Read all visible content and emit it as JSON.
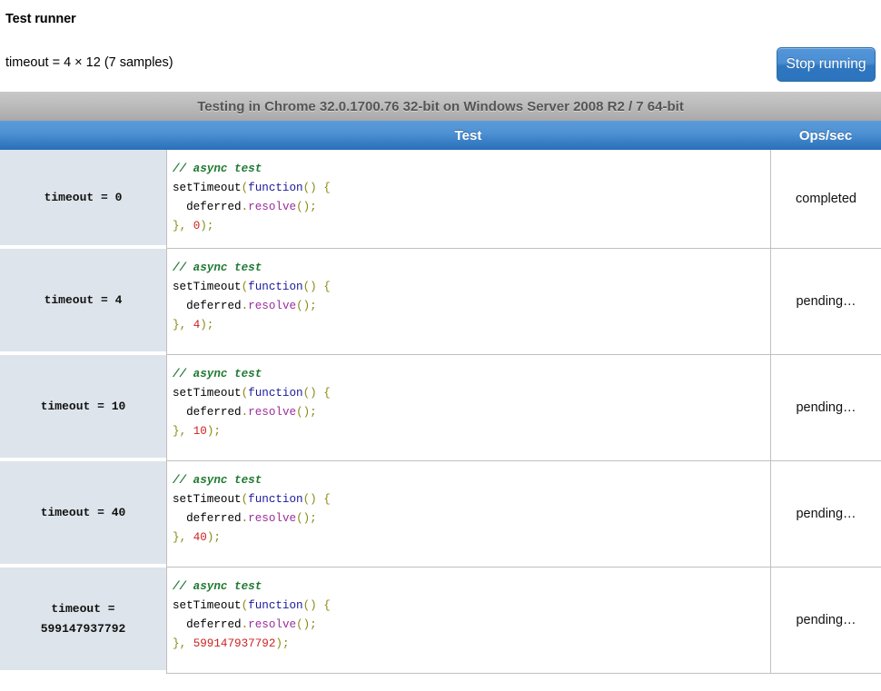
{
  "header": {
    "title": "Test runner",
    "subtitle": "timeout = 4 × 12 (7 samples)",
    "stop_button_label": "Stop running"
  },
  "table": {
    "caption": "Testing in Chrome 32.0.1700.76 32-bit on Windows Server 2008 R2 / 7 64-bit",
    "columns": {
      "name": "",
      "test": "Test",
      "ops": "Ops/sec"
    },
    "rows": [
      {
        "name": "timeout = 0",
        "code": {
          "comment": "// async test",
          "line2_fn": "setTimeout",
          "line2_open": "(",
          "line2_kw": "function",
          "line2_args": "()",
          "line2_brace": " {",
          "line3_indent": "  ",
          "line3_obj": "deferred",
          "line3_dot": ".",
          "line3_meth": "resolve",
          "line3_tail": "();",
          "line4_brace": "}",
          "line4_comma": ", ",
          "line4_num": "0",
          "line4_tail": ");"
        },
        "ops": "completed"
      },
      {
        "name": "timeout = 4",
        "code": {
          "comment": "// async test",
          "line2_fn": "setTimeout",
          "line2_open": "(",
          "line2_kw": "function",
          "line2_args": "()",
          "line2_brace": " {",
          "line3_indent": "  ",
          "line3_obj": "deferred",
          "line3_dot": ".",
          "line3_meth": "resolve",
          "line3_tail": "();",
          "line4_brace": "}",
          "line4_comma": ", ",
          "line4_num": "4",
          "line4_tail": ");"
        },
        "ops": "pending…"
      },
      {
        "name": "timeout = 10",
        "code": {
          "comment": "// async test",
          "line2_fn": "setTimeout",
          "line2_open": "(",
          "line2_kw": "function",
          "line2_args": "()",
          "line2_brace": " {",
          "line3_indent": "  ",
          "line3_obj": "deferred",
          "line3_dot": ".",
          "line3_meth": "resolve",
          "line3_tail": "();",
          "line4_brace": "}",
          "line4_comma": ", ",
          "line4_num": "10",
          "line4_tail": ");"
        },
        "ops": "pending…"
      },
      {
        "name": "timeout = 40",
        "code": {
          "comment": "// async test",
          "line2_fn": "setTimeout",
          "line2_open": "(",
          "line2_kw": "function",
          "line2_args": "()",
          "line2_brace": " {",
          "line3_indent": "  ",
          "line3_obj": "deferred",
          "line3_dot": ".",
          "line3_meth": "resolve",
          "line3_tail": "();",
          "line4_brace": "}",
          "line4_comma": ", ",
          "line4_num": "40",
          "line4_tail": ");"
        },
        "ops": "pending…"
      },
      {
        "name": "timeout = 599147937792",
        "code": {
          "comment": "// async test",
          "line2_fn": "setTimeout",
          "line2_open": "(",
          "line2_kw": "function",
          "line2_args": "()",
          "line2_brace": " {",
          "line3_indent": "  ",
          "line3_obj": "deferred",
          "line3_dot": ".",
          "line3_meth": "resolve",
          "line3_tail": "();",
          "line4_brace": "}",
          "line4_comma": ", ",
          "line4_num": "599147937792",
          "line4_tail": ");"
        },
        "ops": "pending…"
      }
    ]
  },
  "colors": {
    "accent_blue": "#2f76c0",
    "caption_gray": "#b5b5b5",
    "name_cell_bg": "#dde4eb",
    "comment_green": "#1f7a33",
    "keyword_blue": "#1a1a9c",
    "method_purple": "#9b2d9b",
    "number_red": "#cc2222",
    "punct_olive": "#8a8a12"
  }
}
